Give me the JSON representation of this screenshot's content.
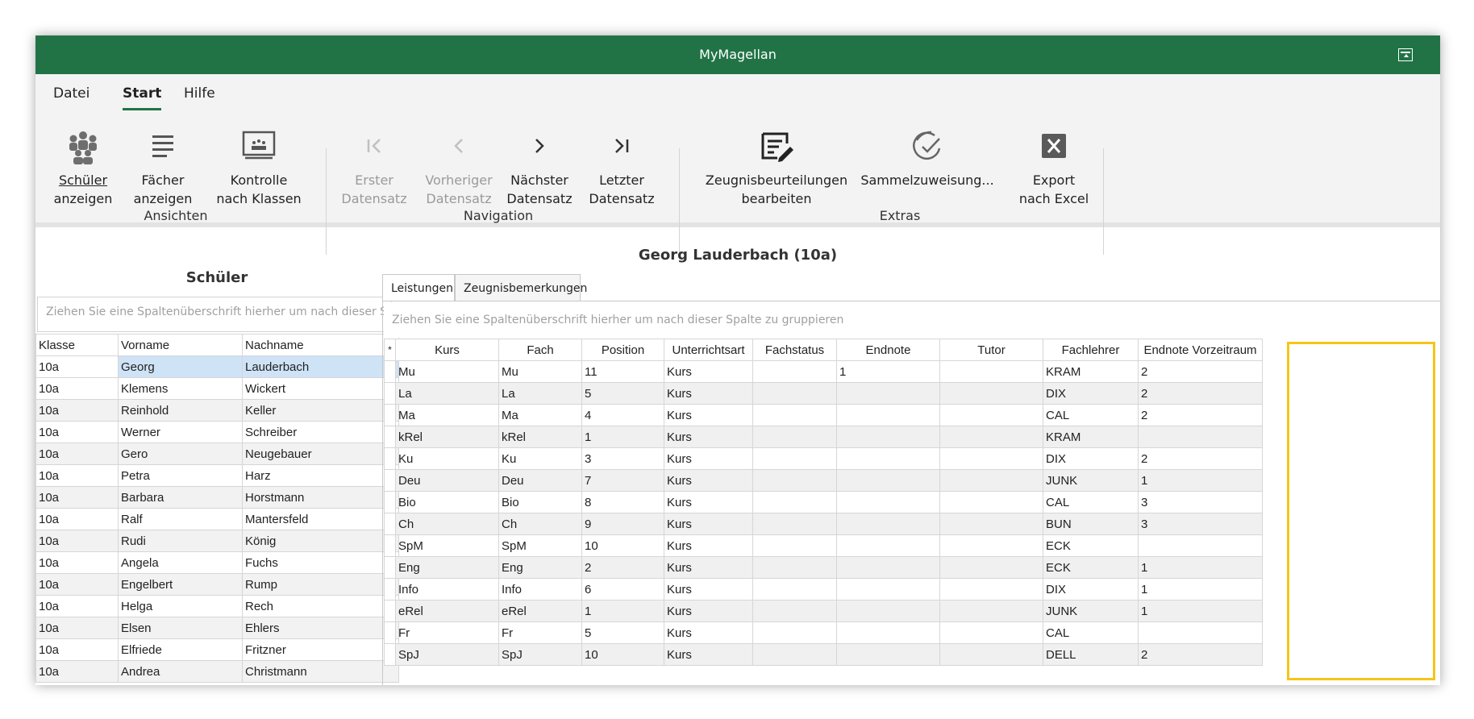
{
  "window": {
    "title": "MyMagellan"
  },
  "menu": {
    "items": [
      {
        "label": "Datei",
        "active": false
      },
      {
        "label": "Start",
        "active": true
      },
      {
        "label": "Hilfe",
        "active": false
      }
    ]
  },
  "ribbon": {
    "groups": {
      "ansichten": "Ansichten",
      "navigation": "Navigation",
      "extras": "Extras"
    },
    "buttons": {
      "schueler": {
        "line1": "Schüler",
        "line2": "anzeigen",
        "icon": "students-icon"
      },
      "faecher": {
        "line1": "Fächer",
        "line2": "anzeigen",
        "icon": "list-icon"
      },
      "kontrolle": {
        "line1": "Kontrolle",
        "line2": "nach Klassen",
        "icon": "classroom-icon"
      },
      "erster": {
        "line1": "Erster",
        "line2": "Datensatz",
        "icon": "first-record-icon",
        "disabled": true
      },
      "vorheriger": {
        "line1": "Vorheriger",
        "line2": "Datensatz",
        "icon": "previous-record-icon",
        "disabled": true
      },
      "naechster": {
        "line1": "Nächster",
        "line2": "Datensatz",
        "icon": "next-record-icon"
      },
      "letzter": {
        "line1": "Letzter",
        "line2": "Datensatz",
        "icon": "last-record-icon"
      },
      "zeugnis": {
        "line1": "Zeugnisbeurteilungen",
        "line2": "bearbeiten",
        "icon": "edit-report-icon"
      },
      "sammel": {
        "line1": "Sammelzuweisung...",
        "line2": "",
        "icon": "check-assign-icon"
      },
      "export": {
        "line1": "Export",
        "line2": "nach Excel",
        "icon": "excel-icon"
      }
    }
  },
  "student_header": "Georg Lauderbach (10a)",
  "left_pane": {
    "title": "Schüler",
    "group_hint": "Ziehen Sie eine Spaltenüberschrift hierher um nach dieser Sp",
    "columns": [
      "Klasse",
      "Vorname",
      "Nachname"
    ],
    "rows": [
      [
        "10a",
        "Georg",
        "Lauderbach"
      ],
      [
        "10a",
        "Klemens",
        "Wickert"
      ],
      [
        "10a",
        "Reinhold",
        "Keller"
      ],
      [
        "10a",
        "Werner",
        "Schreiber"
      ],
      [
        "10a",
        "Gero",
        "Neugebauer"
      ],
      [
        "10a",
        "Petra",
        "Harz"
      ],
      [
        "10a",
        "Barbara",
        "Horstmann"
      ],
      [
        "10a",
        "Ralf",
        "Mantersfeld"
      ],
      [
        "10a",
        "Rudi",
        "König"
      ],
      [
        "10a",
        "Angela",
        "Fuchs"
      ],
      [
        "10a",
        "Engelbert",
        "Rump"
      ],
      [
        "10a",
        "Helga",
        "Rech"
      ],
      [
        "10a",
        "Elsen",
        "Ehlers"
      ],
      [
        "10a",
        "Elfriede",
        "Fritzner"
      ],
      [
        "10a",
        "Andrea",
        "Christmann"
      ]
    ]
  },
  "tabs": [
    {
      "label": "Leistungen",
      "active": true
    },
    {
      "label": "Zeugnisbemerkungen",
      "active": false
    }
  ],
  "grid": {
    "group_hint": "Ziehen Sie eine Spaltenüberschrift hierher um nach dieser Spalte zu gruppieren",
    "newrow_marker": "*",
    "columns": [
      "Kurs",
      "Fach",
      "Position",
      "Unterrichtsart",
      "Fachstatus",
      "Endnote",
      "Tutor",
      "Fachlehrer",
      "Endnote Vorzeitraum"
    ],
    "rows": [
      [
        "Mu",
        "Mu",
        "11",
        "Kurs",
        "",
        "1",
        "",
        "KRAM",
        "2"
      ],
      [
        "La",
        "La",
        "5",
        "Kurs",
        "",
        "",
        "",
        "DIX",
        "2"
      ],
      [
        "Ma",
        "Ma",
        "4",
        "Kurs",
        "",
        "",
        "",
        "CAL",
        "2"
      ],
      [
        "kRel",
        "kRel",
        "1",
        "Kurs",
        "",
        "",
        "",
        "KRAM",
        ""
      ],
      [
        "Ku",
        "Ku",
        "3",
        "Kurs",
        "",
        "",
        "",
        "DIX",
        "2"
      ],
      [
        "Deu",
        "Deu",
        "7",
        "Kurs",
        "",
        "",
        "",
        "JUNK",
        "1"
      ],
      [
        "Bio",
        "Bio",
        "8",
        "Kurs",
        "",
        "",
        "",
        "CAL",
        "3"
      ],
      [
        "Ch",
        "Ch",
        "9",
        "Kurs",
        "",
        "",
        "",
        "BUN",
        "3"
      ],
      [
        "SpM",
        "SpM",
        "10",
        "Kurs",
        "",
        "",
        "",
        "ECK",
        ""
      ],
      [
        "Eng",
        "Eng",
        "2",
        "Kurs",
        "",
        "",
        "",
        "ECK",
        "1"
      ],
      [
        "Info",
        "Info",
        "6",
        "Kurs",
        "",
        "",
        "",
        "DIX",
        "1"
      ],
      [
        "eRel",
        "eRel",
        "1",
        "Kurs",
        "",
        "",
        "",
        "JUNK",
        "1"
      ],
      [
        "Fr",
        "Fr",
        "5",
        "Kurs",
        "",
        "",
        "",
        "CAL",
        ""
      ],
      [
        "SpJ",
        "SpJ",
        "10",
        "Kurs",
        "",
        "",
        "",
        "DELL",
        "2"
      ]
    ]
  },
  "colors": {
    "accent": "#217346",
    "highlight": "#f5c518",
    "selection": "#cfe3f7"
  }
}
